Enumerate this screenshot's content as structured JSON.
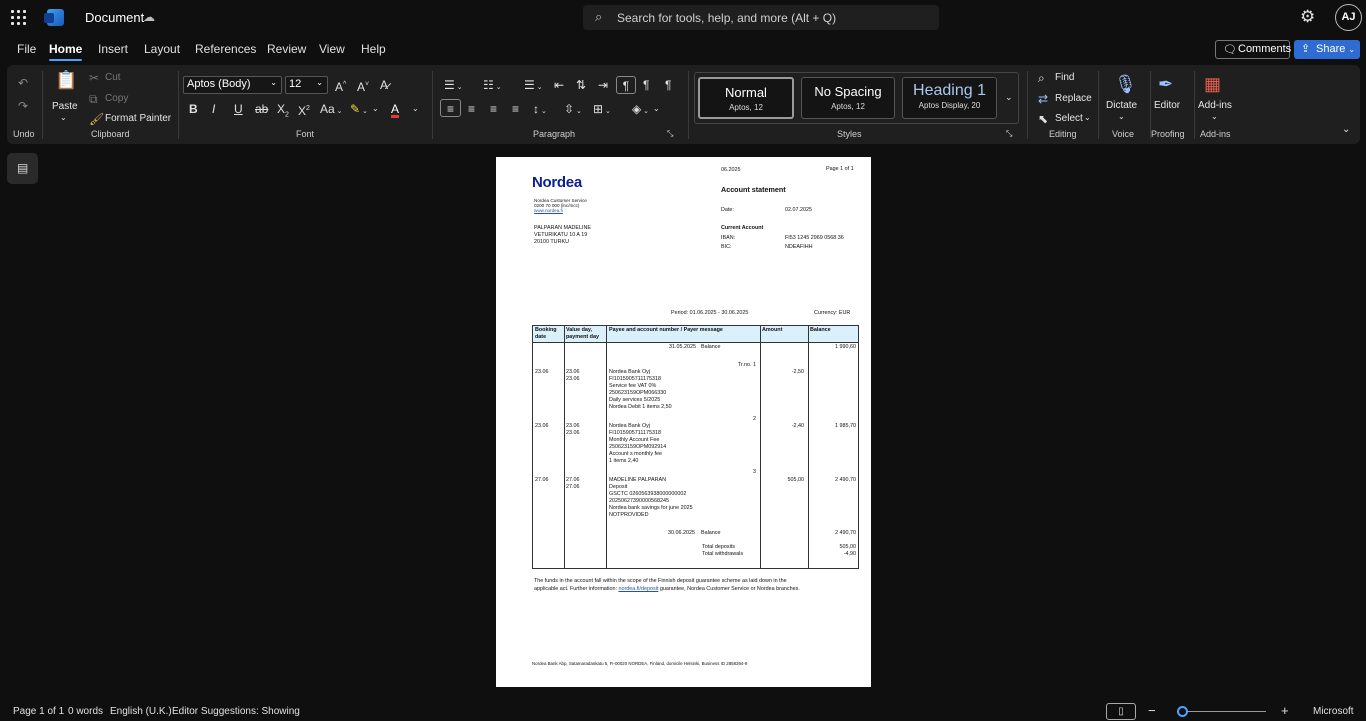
{
  "titlebar": {
    "doc_title": "Document",
    "search_placeholder": "Search for tools, help, and more (Alt + Q)",
    "avatar_initials": "AJ"
  },
  "menu": {
    "items": [
      "File",
      "Home",
      "Insert",
      "Layout",
      "References",
      "Review",
      "View",
      "Help"
    ],
    "active": "Home",
    "comments_label": "Comments",
    "share_label": "Share"
  },
  "ribbon": {
    "undo_group": "Undo",
    "clipboard": {
      "paste": "Paste",
      "cut": "Cut",
      "copy": "Copy",
      "format_painter": "Format Painter",
      "label": "Clipboard"
    },
    "font": {
      "family": "Aptos (Body)",
      "size": "12",
      "label": "Font"
    },
    "paragraph_label": "Paragraph",
    "styles": {
      "label": "Styles",
      "items": [
        {
          "name": "Normal",
          "sub": "Aptos, 12"
        },
        {
          "name": "No Spacing",
          "sub": "Aptos, 12"
        },
        {
          "name": "Heading 1",
          "sub": "Aptos Display, 20"
        }
      ]
    },
    "editing": {
      "find": "Find",
      "replace": "Replace",
      "select": "Select",
      "label": "Editing"
    },
    "voice": {
      "dictate": "Dictate",
      "label": "Voice"
    },
    "proofing": {
      "editor": "Editor",
      "label": "Proofing"
    },
    "addins": {
      "addins": "Add-ins",
      "label": "Add-ins"
    }
  },
  "document": {
    "header_date": "06.2025",
    "page_of": "Page 1 of 1",
    "logo": "Nordea",
    "title": "Account statement",
    "date_label": "Date:",
    "date_value": "02.07.2025",
    "service_lines": [
      "Nordea Customer Service",
      "0200 70 000 (lnc/mcc)"
    ],
    "service_link": "www.nordea.fi",
    "customer": [
      "PALPARAN MADELINE",
      "VETURIKATU 10 A 19",
      "20100 TURKU"
    ],
    "current_account": "Current Account",
    "iban_label": "IBAN:",
    "iban_value": "FI53 1245 2969 0568 36",
    "bic_label": "BIC:",
    "bic_value": "NDEAFIHH",
    "period": "Period: 01.06.2025 - 30.06.2025",
    "currency": "Currency: EUR",
    "table": {
      "headers": {
        "booking": [
          "Booking",
          "date"
        ],
        "value": [
          "Value day,",
          "payment day"
        ],
        "payee": "Payee and account number / Payer message",
        "amount": "Amount",
        "balance": "Balance"
      },
      "opening": {
        "date": "31.05.2025",
        "label": "Balance",
        "balance": "1 990,60"
      },
      "transactions": [
        {
          "trno": "Tr.no. 1",
          "booking": "23.06",
          "value": [
            "23.06",
            "23.06"
          ],
          "lines": [
            "Nordea Bank Oyj",
            "FI1015905711175318",
            "Service fee VAT 0%",
            "250623159OPM066330",
            "Daily services   5/2025",
            "Nordea Debit          1 items   2,50"
          ],
          "amount": "-2,50",
          "balance": ""
        },
        {
          "trno": "2",
          "booking": "23.06",
          "value": [
            "23.06",
            "23.06"
          ],
          "lines": [
            "Nordea Bank Oyj",
            "FI1015905711175318",
            "Monthly Account Fee",
            "250623159OPM092914",
            "Account s monthly fee",
            "1 items   2,40"
          ],
          "amount": "-2,40",
          "balance": "1 985,70"
        },
        {
          "trno": "3",
          "booking": "27.06",
          "value": [
            "27.06",
            "27.06"
          ],
          "lines": [
            "MADELINE PALPARAN",
            "Deposit",
            "GSCTC        0260563938000000002",
            "20250627390000568245",
            "Nordea bank savings for june 2025",
            "NOTPROVIDED"
          ],
          "amount": "505,00",
          "balance": "2 490,70"
        }
      ],
      "closing": {
        "date": "30.06.2025",
        "label": "Balance",
        "balance": "2 490,70"
      },
      "totals": [
        {
          "label": "Total deposits",
          "value": "505,00"
        },
        {
          "label": "Total withdrawals",
          "value": "-4,90"
        }
      ]
    },
    "footnote_1": "The funds in the account fall within the scope of the Finnish deposit guarantee scheme as laid down in the",
    "footnote_2a": "applicable act. Further information: ",
    "footnote_link": "nordea.fi/deposit",
    "footnote_2b": " guarantee, Nordea Customer Service or Nordea branches.",
    "footer": "Nordea Bank Abp, Satamaradankatu 5, FI-00020 NORDEA, Finland, domicile Helsinki, Business ID 2858394-9"
  },
  "statusbar": {
    "page": "Page 1 of 1",
    "words": "0 words",
    "language": "English (U.K.)",
    "editor": "Editor Suggestions: Showing",
    "brand": "Microsoft"
  }
}
